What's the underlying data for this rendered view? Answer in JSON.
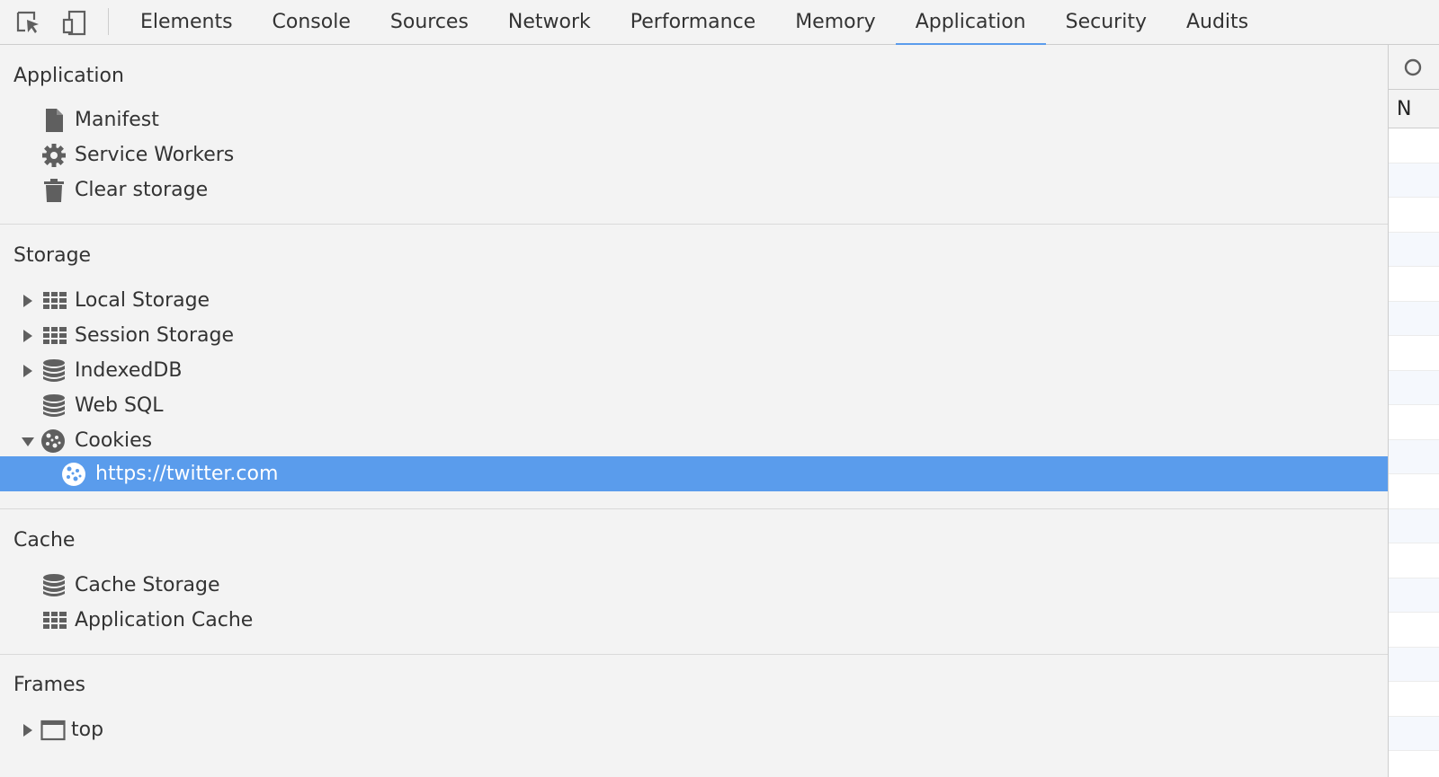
{
  "toolbar": {
    "inspect_icon": "inspect-element-icon",
    "device_icon": "device-toggle-icon",
    "tabs": [
      {
        "label": "Elements"
      },
      {
        "label": "Console"
      },
      {
        "label": "Sources"
      },
      {
        "label": "Network"
      },
      {
        "label": "Performance"
      },
      {
        "label": "Memory"
      },
      {
        "label": "Application",
        "active": true
      },
      {
        "label": "Security"
      },
      {
        "label": "Audits"
      }
    ]
  },
  "sidebar": {
    "application": {
      "title": "Application",
      "items": [
        {
          "label": "Manifest",
          "icon": "document-icon"
        },
        {
          "label": "Service Workers",
          "icon": "gear-icon"
        },
        {
          "label": "Clear storage",
          "icon": "trash-icon"
        }
      ]
    },
    "storage": {
      "title": "Storage",
      "items": [
        {
          "label": "Local Storage",
          "icon": "grid-icon",
          "expandable": true
        },
        {
          "label": "Session Storage",
          "icon": "grid-icon",
          "expandable": true
        },
        {
          "label": "IndexedDB",
          "icon": "database-icon",
          "expandable": true
        },
        {
          "label": "Web SQL",
          "icon": "database-icon"
        },
        {
          "label": "Cookies",
          "icon": "cookie-icon",
          "expanded": true
        },
        {
          "label": "https://twitter.com",
          "icon": "cookie-icon",
          "selected": true
        }
      ]
    },
    "cache": {
      "title": "Cache",
      "items": [
        {
          "label": "Cache Storage",
          "icon": "database-icon"
        },
        {
          "label": "Application Cache",
          "icon": "grid-icon"
        }
      ]
    },
    "frames": {
      "title": "Frames",
      "items": [
        {
          "label": "top",
          "icon": "frame-icon",
          "expandable": true
        }
      ]
    }
  },
  "right_pane": {
    "column_header": "N"
  },
  "colors": {
    "selection": "#5a9cec",
    "background": "#f3f3f3",
    "icon": "#5f5f5f"
  }
}
